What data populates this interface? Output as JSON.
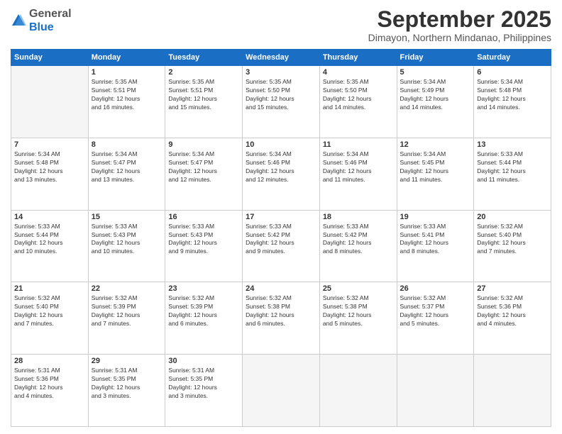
{
  "logo": {
    "general": "General",
    "blue": "Blue"
  },
  "header": {
    "month": "September 2025",
    "location": "Dimayon, Northern Mindanao, Philippines"
  },
  "columns": [
    "Sunday",
    "Monday",
    "Tuesday",
    "Wednesday",
    "Thursday",
    "Friday",
    "Saturday"
  ],
  "weeks": [
    [
      {
        "num": "",
        "info": ""
      },
      {
        "num": "1",
        "info": "Sunrise: 5:35 AM\nSunset: 5:51 PM\nDaylight: 12 hours\nand 16 minutes."
      },
      {
        "num": "2",
        "info": "Sunrise: 5:35 AM\nSunset: 5:51 PM\nDaylight: 12 hours\nand 15 minutes."
      },
      {
        "num": "3",
        "info": "Sunrise: 5:35 AM\nSunset: 5:50 PM\nDaylight: 12 hours\nand 15 minutes."
      },
      {
        "num": "4",
        "info": "Sunrise: 5:35 AM\nSunset: 5:50 PM\nDaylight: 12 hours\nand 14 minutes."
      },
      {
        "num": "5",
        "info": "Sunrise: 5:34 AM\nSunset: 5:49 PM\nDaylight: 12 hours\nand 14 minutes."
      },
      {
        "num": "6",
        "info": "Sunrise: 5:34 AM\nSunset: 5:48 PM\nDaylight: 12 hours\nand 14 minutes."
      }
    ],
    [
      {
        "num": "7",
        "info": "Sunrise: 5:34 AM\nSunset: 5:48 PM\nDaylight: 12 hours\nand 13 minutes."
      },
      {
        "num": "8",
        "info": "Sunrise: 5:34 AM\nSunset: 5:47 PM\nDaylight: 12 hours\nand 13 minutes."
      },
      {
        "num": "9",
        "info": "Sunrise: 5:34 AM\nSunset: 5:47 PM\nDaylight: 12 hours\nand 12 minutes."
      },
      {
        "num": "10",
        "info": "Sunrise: 5:34 AM\nSunset: 5:46 PM\nDaylight: 12 hours\nand 12 minutes."
      },
      {
        "num": "11",
        "info": "Sunrise: 5:34 AM\nSunset: 5:46 PM\nDaylight: 12 hours\nand 11 minutes."
      },
      {
        "num": "12",
        "info": "Sunrise: 5:34 AM\nSunset: 5:45 PM\nDaylight: 12 hours\nand 11 minutes."
      },
      {
        "num": "13",
        "info": "Sunrise: 5:33 AM\nSunset: 5:44 PM\nDaylight: 12 hours\nand 11 minutes."
      }
    ],
    [
      {
        "num": "14",
        "info": "Sunrise: 5:33 AM\nSunset: 5:44 PM\nDaylight: 12 hours\nand 10 minutes."
      },
      {
        "num": "15",
        "info": "Sunrise: 5:33 AM\nSunset: 5:43 PM\nDaylight: 12 hours\nand 10 minutes."
      },
      {
        "num": "16",
        "info": "Sunrise: 5:33 AM\nSunset: 5:43 PM\nDaylight: 12 hours\nand 9 minutes."
      },
      {
        "num": "17",
        "info": "Sunrise: 5:33 AM\nSunset: 5:42 PM\nDaylight: 12 hours\nand 9 minutes."
      },
      {
        "num": "18",
        "info": "Sunrise: 5:33 AM\nSunset: 5:42 PM\nDaylight: 12 hours\nand 8 minutes."
      },
      {
        "num": "19",
        "info": "Sunrise: 5:33 AM\nSunset: 5:41 PM\nDaylight: 12 hours\nand 8 minutes."
      },
      {
        "num": "20",
        "info": "Sunrise: 5:32 AM\nSunset: 5:40 PM\nDaylight: 12 hours\nand 7 minutes."
      }
    ],
    [
      {
        "num": "21",
        "info": "Sunrise: 5:32 AM\nSunset: 5:40 PM\nDaylight: 12 hours\nand 7 minutes."
      },
      {
        "num": "22",
        "info": "Sunrise: 5:32 AM\nSunset: 5:39 PM\nDaylight: 12 hours\nand 7 minutes."
      },
      {
        "num": "23",
        "info": "Sunrise: 5:32 AM\nSunset: 5:39 PM\nDaylight: 12 hours\nand 6 minutes."
      },
      {
        "num": "24",
        "info": "Sunrise: 5:32 AM\nSunset: 5:38 PM\nDaylight: 12 hours\nand 6 minutes."
      },
      {
        "num": "25",
        "info": "Sunrise: 5:32 AM\nSunset: 5:38 PM\nDaylight: 12 hours\nand 5 minutes."
      },
      {
        "num": "26",
        "info": "Sunrise: 5:32 AM\nSunset: 5:37 PM\nDaylight: 12 hours\nand 5 minutes."
      },
      {
        "num": "27",
        "info": "Sunrise: 5:32 AM\nSunset: 5:36 PM\nDaylight: 12 hours\nand 4 minutes."
      }
    ],
    [
      {
        "num": "28",
        "info": "Sunrise: 5:31 AM\nSunset: 5:36 PM\nDaylight: 12 hours\nand 4 minutes."
      },
      {
        "num": "29",
        "info": "Sunrise: 5:31 AM\nSunset: 5:35 PM\nDaylight: 12 hours\nand 3 minutes."
      },
      {
        "num": "30",
        "info": "Sunrise: 5:31 AM\nSunset: 5:35 PM\nDaylight: 12 hours\nand 3 minutes."
      },
      {
        "num": "",
        "info": ""
      },
      {
        "num": "",
        "info": ""
      },
      {
        "num": "",
        "info": ""
      },
      {
        "num": "",
        "info": ""
      }
    ]
  ]
}
